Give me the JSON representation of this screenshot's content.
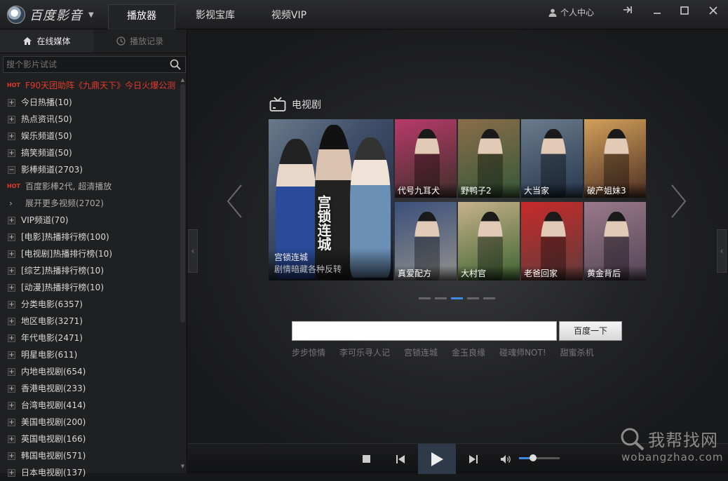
{
  "app": {
    "name": "百度影音"
  },
  "top_tabs": [
    {
      "label": "播放器",
      "active": true
    },
    {
      "label": "影视宝库",
      "active": false
    },
    {
      "label": "视频VIP",
      "active": false
    }
  ],
  "user_center": "个人中心",
  "sidebar": {
    "tabs": [
      {
        "label": "在线媒体",
        "icon": "home-icon",
        "active": true
      },
      {
        "label": "播放记录",
        "icon": "clock-icon",
        "active": false
      }
    ],
    "search_placeholder": "搜个影片试试",
    "items": [
      {
        "type": "hot",
        "label": "F90天团助阵《九鼎天下》今日火爆公测"
      },
      {
        "type": "plus",
        "label": "今日热播(10)"
      },
      {
        "type": "plus",
        "label": "热点资讯(50)"
      },
      {
        "type": "plus",
        "label": "娱乐频道(50)"
      },
      {
        "type": "plus",
        "label": "搞笑频道(50)"
      },
      {
        "type": "minus",
        "label": "影棒频道(2703)"
      },
      {
        "type": "hot-sub",
        "label": "百度影棒2代, 超清播放"
      },
      {
        "type": "expand",
        "label": "展开更多视频(2702)"
      },
      {
        "type": "plus",
        "label": "VIP频道(70)"
      },
      {
        "type": "plus",
        "label": "[电影]热播排行榜(100)"
      },
      {
        "type": "plus",
        "label": "[电视剧]热播排行榜(10)"
      },
      {
        "type": "plus",
        "label": "[综艺]热播排行榜(10)"
      },
      {
        "type": "plus",
        "label": "[动漫]热播排行榜(10)"
      },
      {
        "type": "plus",
        "label": "分类电影(6357)"
      },
      {
        "type": "plus",
        "label": "地区电影(3271)"
      },
      {
        "type": "plus",
        "label": "年代电影(2471)"
      },
      {
        "type": "plus",
        "label": "明星电影(611)"
      },
      {
        "type": "plus",
        "label": "内地电视剧(654)"
      },
      {
        "type": "plus",
        "label": "香港电视剧(233)"
      },
      {
        "type": "plus",
        "label": "台湾电视剧(414)"
      },
      {
        "type": "plus",
        "label": "美国电视剧(200)"
      },
      {
        "type": "plus",
        "label": "英国电视剧(166)"
      },
      {
        "type": "plus",
        "label": "韩国电视剧(571)"
      },
      {
        "type": "plus",
        "label": "日本电视剧(137)"
      }
    ],
    "hot_tag": "HOT"
  },
  "section": {
    "title": "电视剧",
    "icon": "tv-icon"
  },
  "featured": {
    "title": "宫锁连城",
    "subtitle": "剧情暗藏各种反转",
    "poster_text": "宫锁连城"
  },
  "thumbs": [
    {
      "label": "代号九耳犬"
    },
    {
      "label": "野鸭子2"
    },
    {
      "label": "大当家"
    },
    {
      "label": "破产姐妹3"
    },
    {
      "label": "真爱配方"
    },
    {
      "label": "大村官"
    },
    {
      "label": "老爸回家"
    },
    {
      "label": "黄金背后"
    }
  ],
  "carousel": {
    "pages": 5,
    "active_page": 3
  },
  "search": {
    "button": "百度一下",
    "value": ""
  },
  "hotwords": [
    "步步惊情",
    "李可乐寻人记",
    "宫锁连城",
    "金玉良缘",
    "碰魂师NOT!",
    "甜蜜杀机"
  ],
  "player": {
    "volume": 0.35
  },
  "watermark": {
    "text": "我帮找网",
    "url": "wobangzhao.com"
  },
  "colors": {
    "accent": "#3f8be0",
    "hot": "#e23b2e"
  }
}
